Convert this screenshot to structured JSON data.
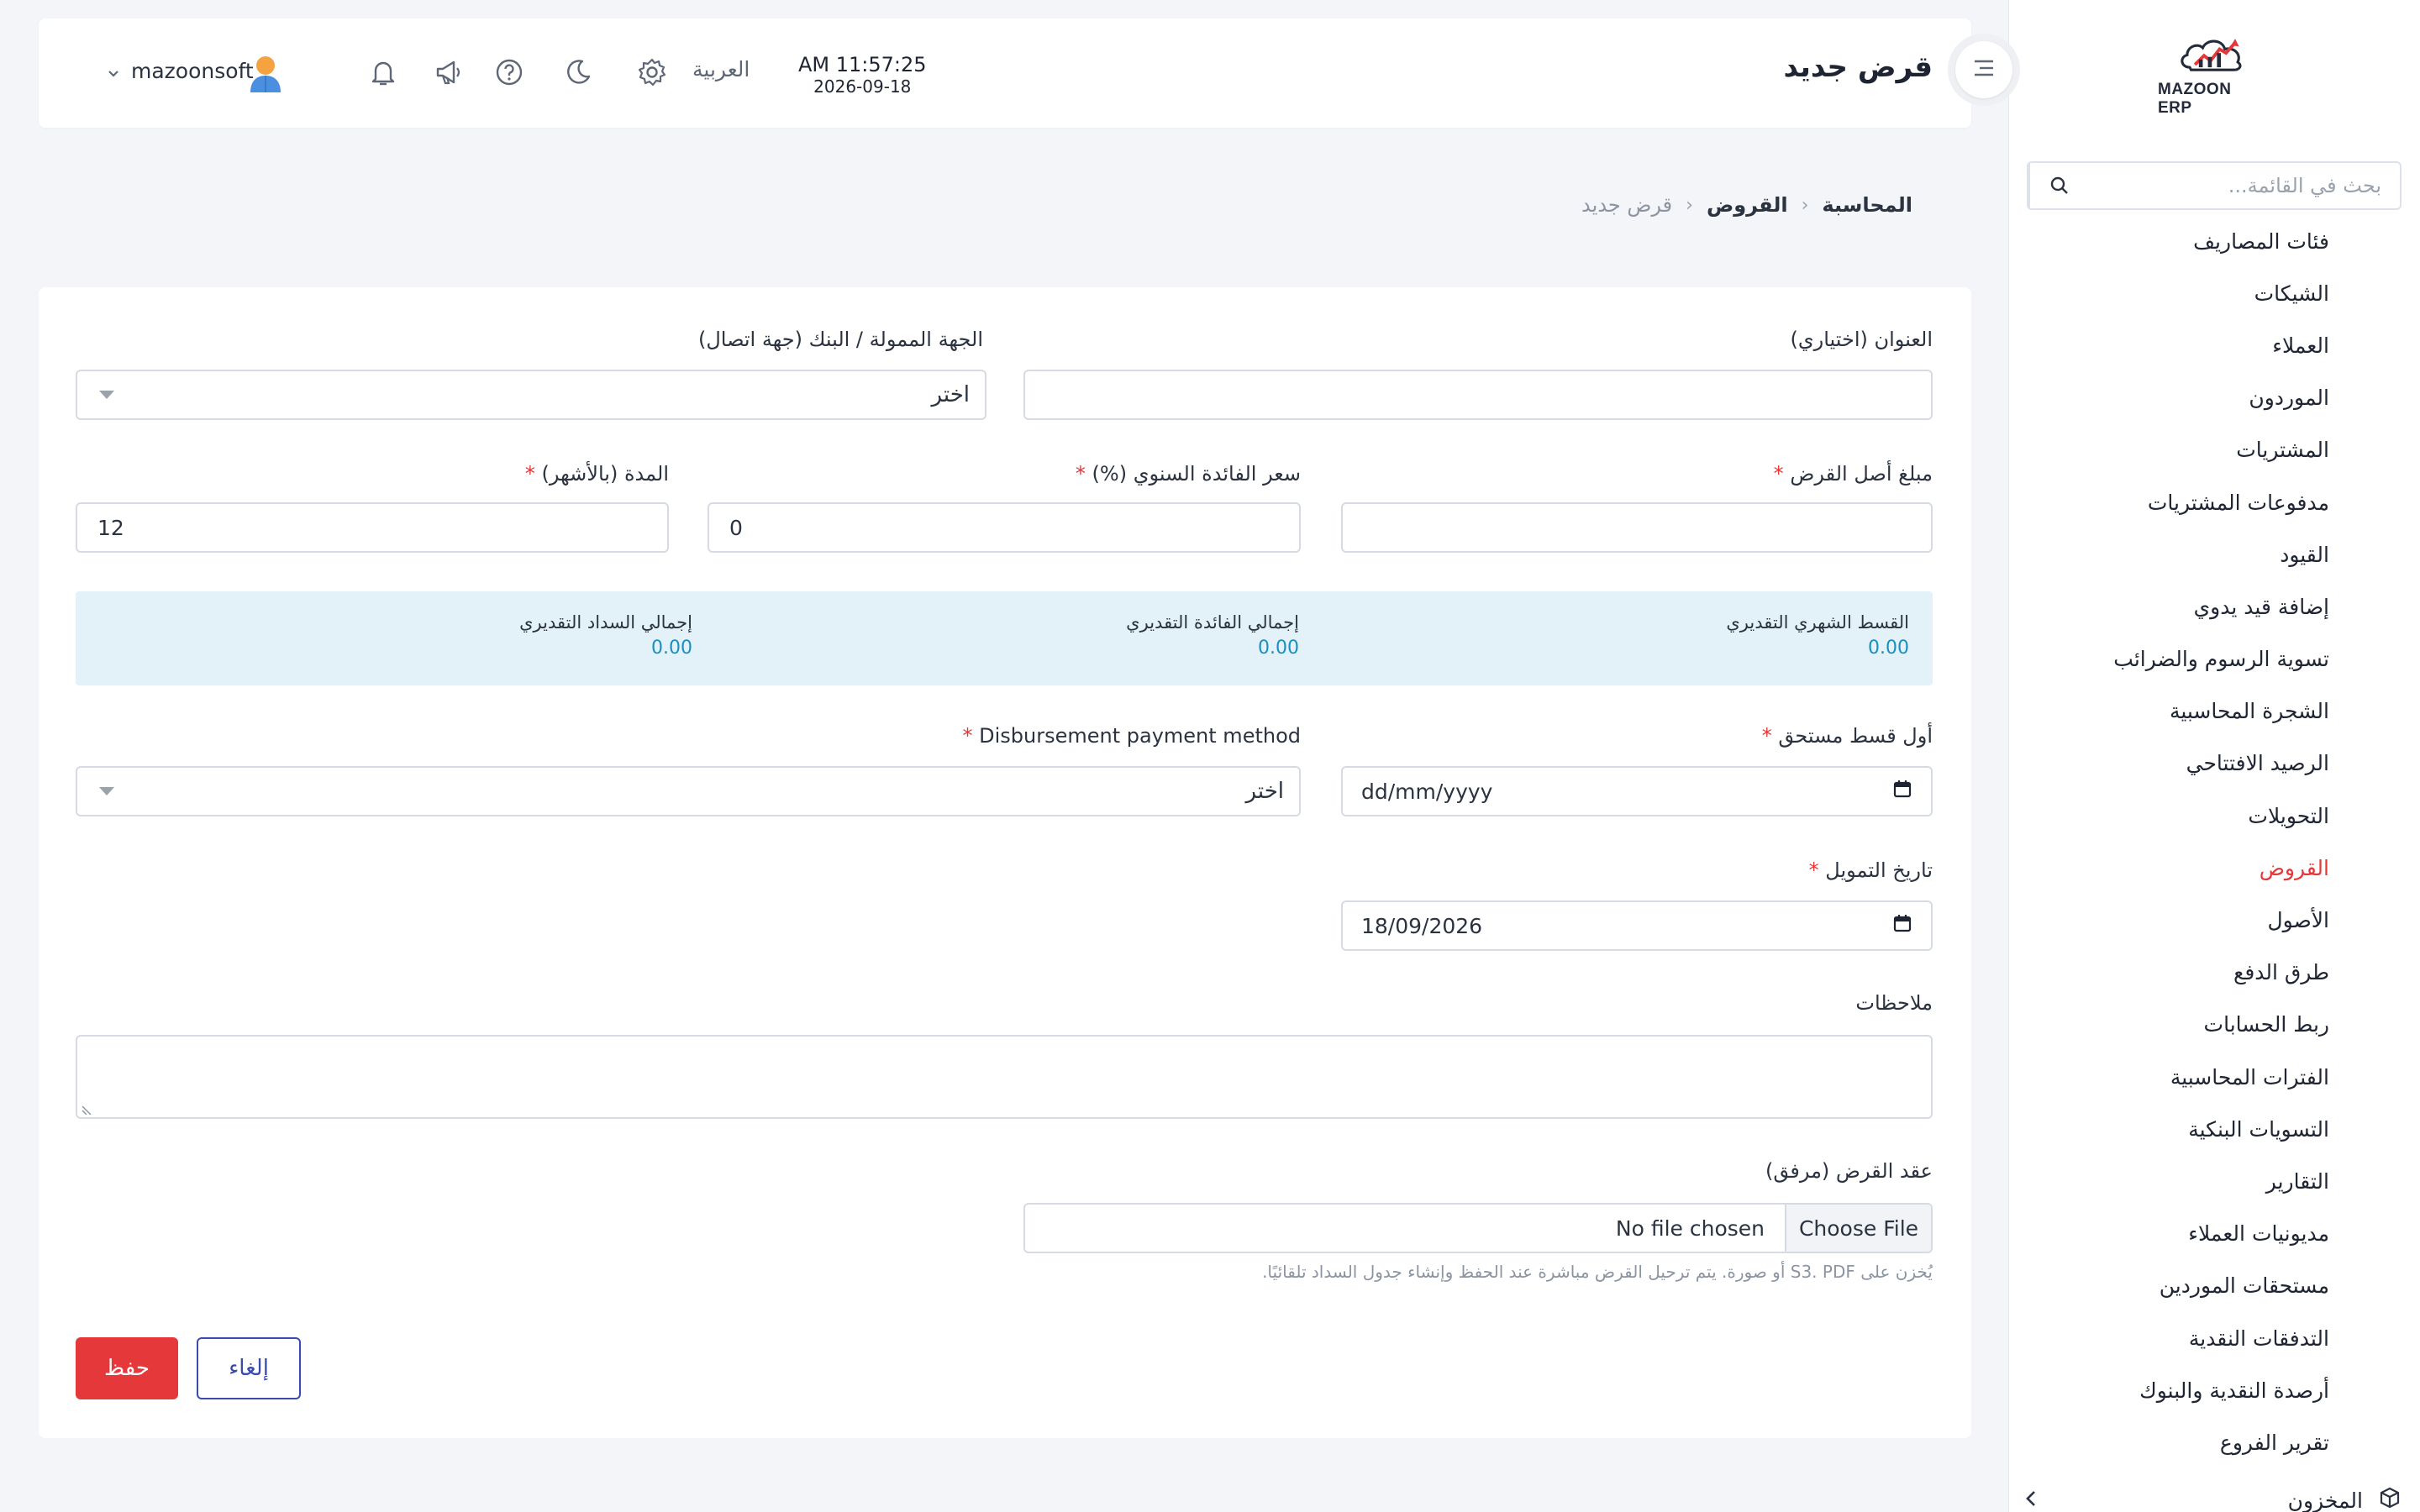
{
  "app": {
    "logo_text": "MAZOON ERP",
    "logo_small": "ERP|ERP"
  },
  "header": {
    "title": "قرض جديد",
    "time": "AM 11:57:25",
    "date": "2026-09-18",
    "language": "العربية",
    "username": "mazoonsoft"
  },
  "sidebar": {
    "search_placeholder": "بحث في القائمة...",
    "items": [
      {
        "label": "فئات المصاريف"
      },
      {
        "label": "الشيكات"
      },
      {
        "label": "العملاء"
      },
      {
        "label": "الموردون"
      },
      {
        "label": "المشتريات"
      },
      {
        "label": "مدفوعات المشتريات"
      },
      {
        "label": "القيود"
      },
      {
        "label": "إضافة قيد يدوي"
      },
      {
        "label": "تسوية الرسوم والضرائب"
      },
      {
        "label": "الشجرة المحاسبية"
      },
      {
        "label": "الرصيد الافتتاحي"
      },
      {
        "label": "التحويلات"
      },
      {
        "label": "القروض",
        "active": true
      },
      {
        "label": "الأصول"
      },
      {
        "label": "طرق الدفع"
      },
      {
        "label": "ربط الحسابات"
      },
      {
        "label": "الفترات المحاسبية"
      },
      {
        "label": "التسويات البنكية"
      },
      {
        "label": "التقارير"
      },
      {
        "label": "مديونيات العملاء"
      },
      {
        "label": "مستحقات الموردين"
      },
      {
        "label": "التدفقات النقدية"
      },
      {
        "label": "أرصدة النقدية والبنوك"
      },
      {
        "label": "تقرير الفروع"
      }
    ],
    "group_label": "المخزون"
  },
  "breadcrumb": {
    "level1": "المحاسبة",
    "level2": "القروض",
    "current": "قرض جديد"
  },
  "form": {
    "title_label": "العنوان (اختياري)",
    "title_value": "",
    "lender_label": "الجهة الممولة / البنك (جهة اتصال)",
    "lender_value": "اختر",
    "principal_label": "مبلغ أصل القرض",
    "principal_value": "",
    "rate_label": "سعر الفائدة السنوي (%)",
    "rate_value": "0",
    "term_label": "المدة (بالأشهر)",
    "term_value": "12",
    "required_mark": "*",
    "summary": {
      "monthly_label": "القسط الشهري التقديري",
      "monthly_value": "0.00",
      "interest_label": "إجمالي الفائدة التقديري",
      "interest_value": "0.00",
      "repayment_label": "إجمالي السداد التقديري",
      "repayment_value": "0.00"
    },
    "first_installment_label": "أول قسط مستحق",
    "first_installment_value": "dd/mm/yyyy",
    "disbursement_label": "Disbursement payment method",
    "disbursement_value": "اختر",
    "funding_date_label": "تاريخ التمويل",
    "funding_date_value": "18/09/2026",
    "notes_label": "ملاحظات",
    "contract_label": "عقد القرض (مرفق)",
    "file_button": "Choose File",
    "file_status": "No file chosen",
    "hint": "يُخزن على S3. PDF أو صورة. يتم ترحيل القرض مباشرة عند الحفظ وإنشاء جدول السداد تلقائيًا."
  },
  "actions": {
    "save": "حفظ",
    "cancel": "إلغاء"
  },
  "colors": {
    "accent_red": "#e5383b",
    "accent_blue": "#3a4bb0",
    "summary_bg": "#e2f2f8",
    "summary_value": "#1a8fbf"
  }
}
